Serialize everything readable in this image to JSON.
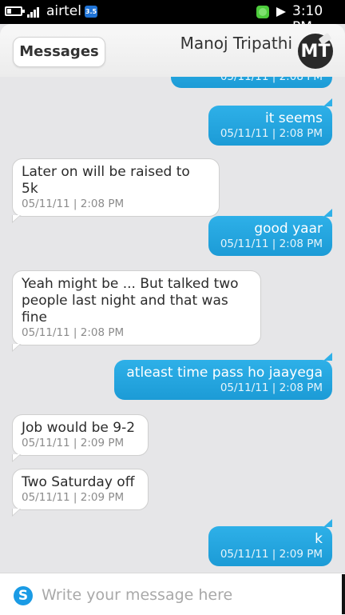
{
  "status_bar": {
    "carrier": "airtel",
    "network_badge": "3.5",
    "time": "3:10 PM"
  },
  "header": {
    "back_label": "Messages",
    "contact_name": "Manoj Tripathi",
    "avatar_initials": "MT"
  },
  "thread": {
    "partial_top_meta": "05/11/11 | 2:08 PM",
    "messages": [
      {
        "direction": "out",
        "text": "it seems",
        "meta": "05/11/11 | 2:08 PM"
      },
      {
        "direction": "in",
        "text": "Later on will be raised to 5k",
        "meta": "05/11/11 | 2:08 PM"
      },
      {
        "direction": "out",
        "text": "good yaar",
        "meta": "05/11/11 | 2:08 PM"
      },
      {
        "direction": "in",
        "text": "Yeah might be ... But talked two people last night and that was fine",
        "meta": "05/11/11 | 2:08 PM"
      },
      {
        "direction": "out",
        "text": "atleast time pass ho jaayega",
        "meta": "05/11/11 | 2:08 PM"
      },
      {
        "direction": "in",
        "text": "Job would be 9-2",
        "meta": "05/11/11 | 2:09 PM"
      },
      {
        "direction": "in",
        "text": "Two Saturday off",
        "meta": "05/11/11 | 2:09 PM"
      },
      {
        "direction": "out",
        "text": "k",
        "meta": "05/11/11 | 2:09 PM"
      }
    ]
  },
  "composer": {
    "placeholder": "Write your message here"
  },
  "colors": {
    "outgoing_bubble": "#24a3de",
    "incoming_bubble": "#ffffff",
    "background": "#e6e6e8"
  }
}
